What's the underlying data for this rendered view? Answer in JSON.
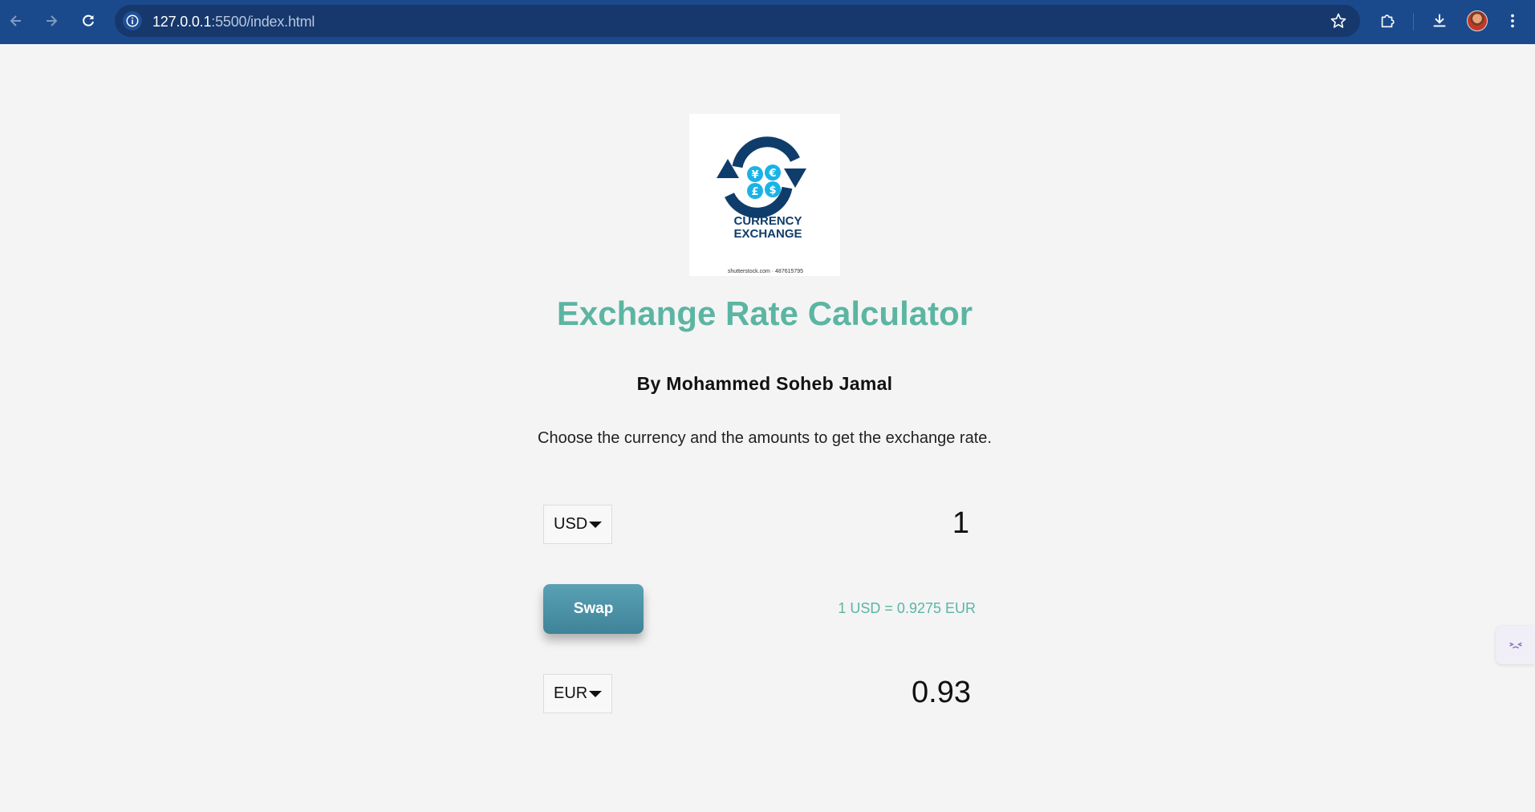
{
  "browser": {
    "url_host": "127.0.0.1",
    "url_path": ":5500/index.html",
    "icons": {
      "back": "arrow-left-icon",
      "forward": "arrow-right-icon",
      "reload": "reload-icon",
      "site_info": "info-icon",
      "bookmark": "star-icon",
      "extensions": "puzzle-icon",
      "downloads": "download-icon",
      "profile": "avatar",
      "menu": "kebab-menu-icon"
    },
    "colors": {
      "toolbar": "#1b4a8c",
      "omnibox": "#16386c"
    }
  },
  "page": {
    "logo": {
      "line1": "CURRENCY",
      "line2": "EXCHANGE",
      "watermark": "shutterstock.com · 487615795"
    },
    "title": "Exchange Rate Calculator",
    "author": "By Mohammed Soheb Jamal",
    "instructions": "Choose the currency and the amounts to get the exchange rate.",
    "from": {
      "currency": "USD",
      "amount": "1"
    },
    "swap_label": "Swap",
    "rate_text": "1 USD = 0.9275 EUR",
    "to": {
      "currency": "EUR",
      "amount": "0.93"
    },
    "colors": {
      "accent": "#5bb5a2",
      "button": "#4a90a6",
      "background": "#f4f4f4"
    }
  }
}
